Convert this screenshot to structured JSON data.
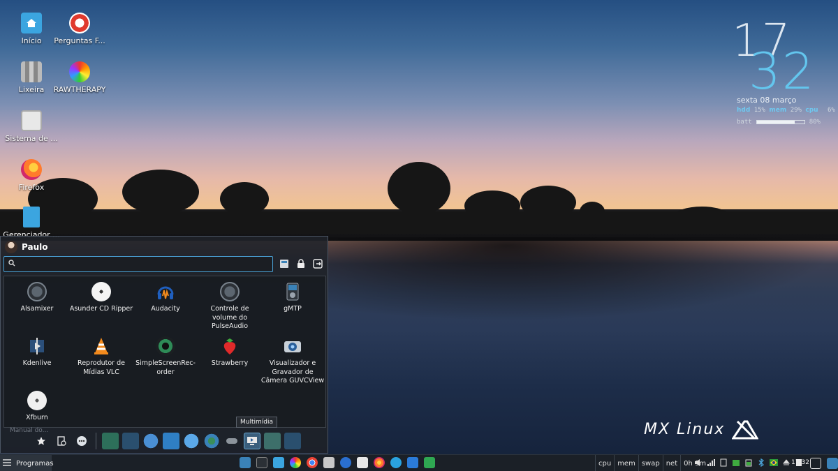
{
  "desktop": {
    "icons": [
      {
        "label": "Início"
      },
      {
        "label": "Perguntas F..."
      },
      {
        "label": "Lixeira"
      },
      {
        "label": "RAWTHERAPY"
      },
      {
        "label": "Sistema de ..."
      },
      {
        "label": "Firefox"
      },
      {
        "label": "Gerenciador ..."
      }
    ],
    "manual_ghost": "Manual do..."
  },
  "conky": {
    "hour": "17",
    "minute": "32",
    "date": "sexta  08 março",
    "hdd_label": "hdd",
    "hdd_value": "15%",
    "mem_label": "mem",
    "mem_value": "29%",
    "cpu_label": "cpu",
    "cpu_value": "6%",
    "batt_label": "batt",
    "batt_value": "80%",
    "batt_fraction": 0.8
  },
  "branding": {
    "logo_text": "MX Linux"
  },
  "menu": {
    "user": "Paulo",
    "search": {
      "value": "",
      "placeholder": ""
    },
    "apps": [
      {
        "label": "Alsamixer",
        "icon": "knob-icon"
      },
      {
        "label": "Asunder CD Ripper",
        "icon": "cd-icon"
      },
      {
        "label": "Audacity",
        "icon": "headphones-icon"
      },
      {
        "label": "Controle de volume do PulseAudio",
        "icon": "knob-icon"
      },
      {
        "label": "gMTP",
        "icon": "media-player-icon"
      },
      {
        "label": "Kdenlive",
        "icon": "film-icon"
      },
      {
        "label": "Reprodutor de Mídias VLC",
        "icon": "traffic-cone-icon"
      },
      {
        "label": "SimpleScreenRec-order",
        "icon": "camera-lens-icon"
      },
      {
        "label": "Strawberry",
        "icon": "strawberry-icon"
      },
      {
        "label": "Visualizador e Gravador de Câmera GUVCView",
        "icon": "webcam-icon"
      },
      {
        "label": "Xfburn",
        "icon": "disc-burn-icon"
      }
    ],
    "tooltip": "Multimídia"
  },
  "taskbar": {
    "start_label": "Programas",
    "monitors": [
      "cpu",
      "mem",
      "swap",
      "net",
      "0h 9m"
    ],
    "time": "17:32"
  },
  "colors": {
    "accent": "#4aa3d8",
    "clock_minute": "#63c6ee"
  }
}
